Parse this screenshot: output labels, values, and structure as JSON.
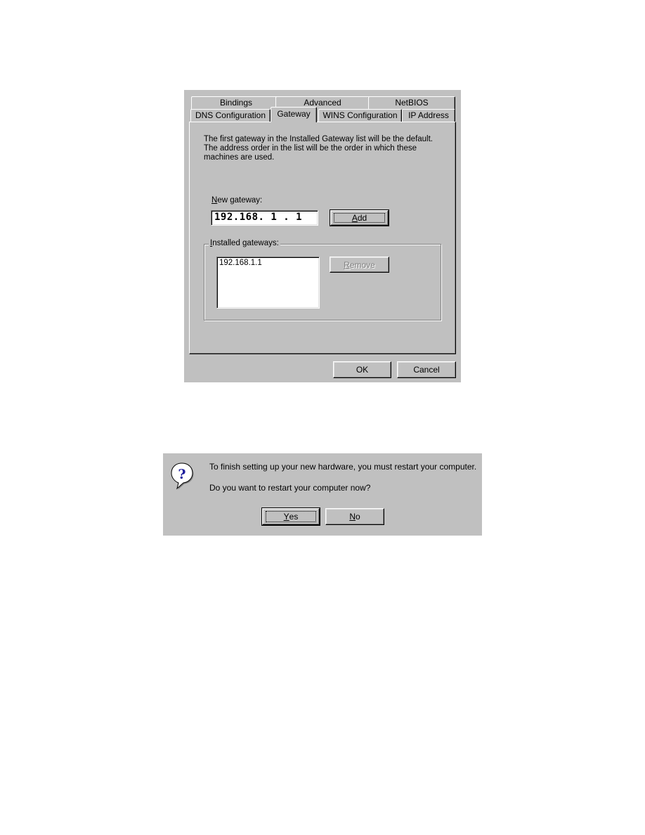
{
  "tcpip_dialog": {
    "tabs_back_row": [
      {
        "label": "Bindings"
      },
      {
        "label": "Advanced"
      },
      {
        "label": "NetBIOS"
      }
    ],
    "tabs_front_row": [
      {
        "label": "DNS Configuration"
      },
      {
        "label": "Gateway",
        "active": true
      },
      {
        "label": "WINS Configuration"
      },
      {
        "label": "IP Address"
      }
    ],
    "intro_lines": [
      "The first gateway in the Installed Gateway list will be the default.",
      "The address order in the list will be the order in which these",
      "machines are used."
    ],
    "new_gateway": {
      "label_accel": "N",
      "label_rest": "ew gateway:",
      "octets": [
        "192",
        "168",
        "1",
        "1"
      ]
    },
    "add_button": {
      "accel": "A",
      "rest": "dd"
    },
    "installed_gateways": {
      "legend_accel": "I",
      "legend_rest": "nstalled gateways:",
      "items": [
        "192.168.1.1"
      ]
    },
    "remove_button": {
      "accel": "R",
      "rest": "emove",
      "disabled": true
    },
    "ok_label": "OK",
    "cancel_label": "Cancel"
  },
  "restart_dialog": {
    "icon": "question-icon",
    "message": "To finish setting up your new hardware, you must restart your computer.",
    "question": "Do you want to restart your computer now?",
    "yes_button": {
      "accel": "Y",
      "rest": "es"
    },
    "no_button": {
      "accel": "N",
      "rest": "o"
    }
  },
  "colors": {
    "face": "#c0c0c0",
    "highlight": "#ffffff",
    "shadow": "#808080",
    "dark": "#000000",
    "icon_glyph": "#1a1a9c"
  }
}
